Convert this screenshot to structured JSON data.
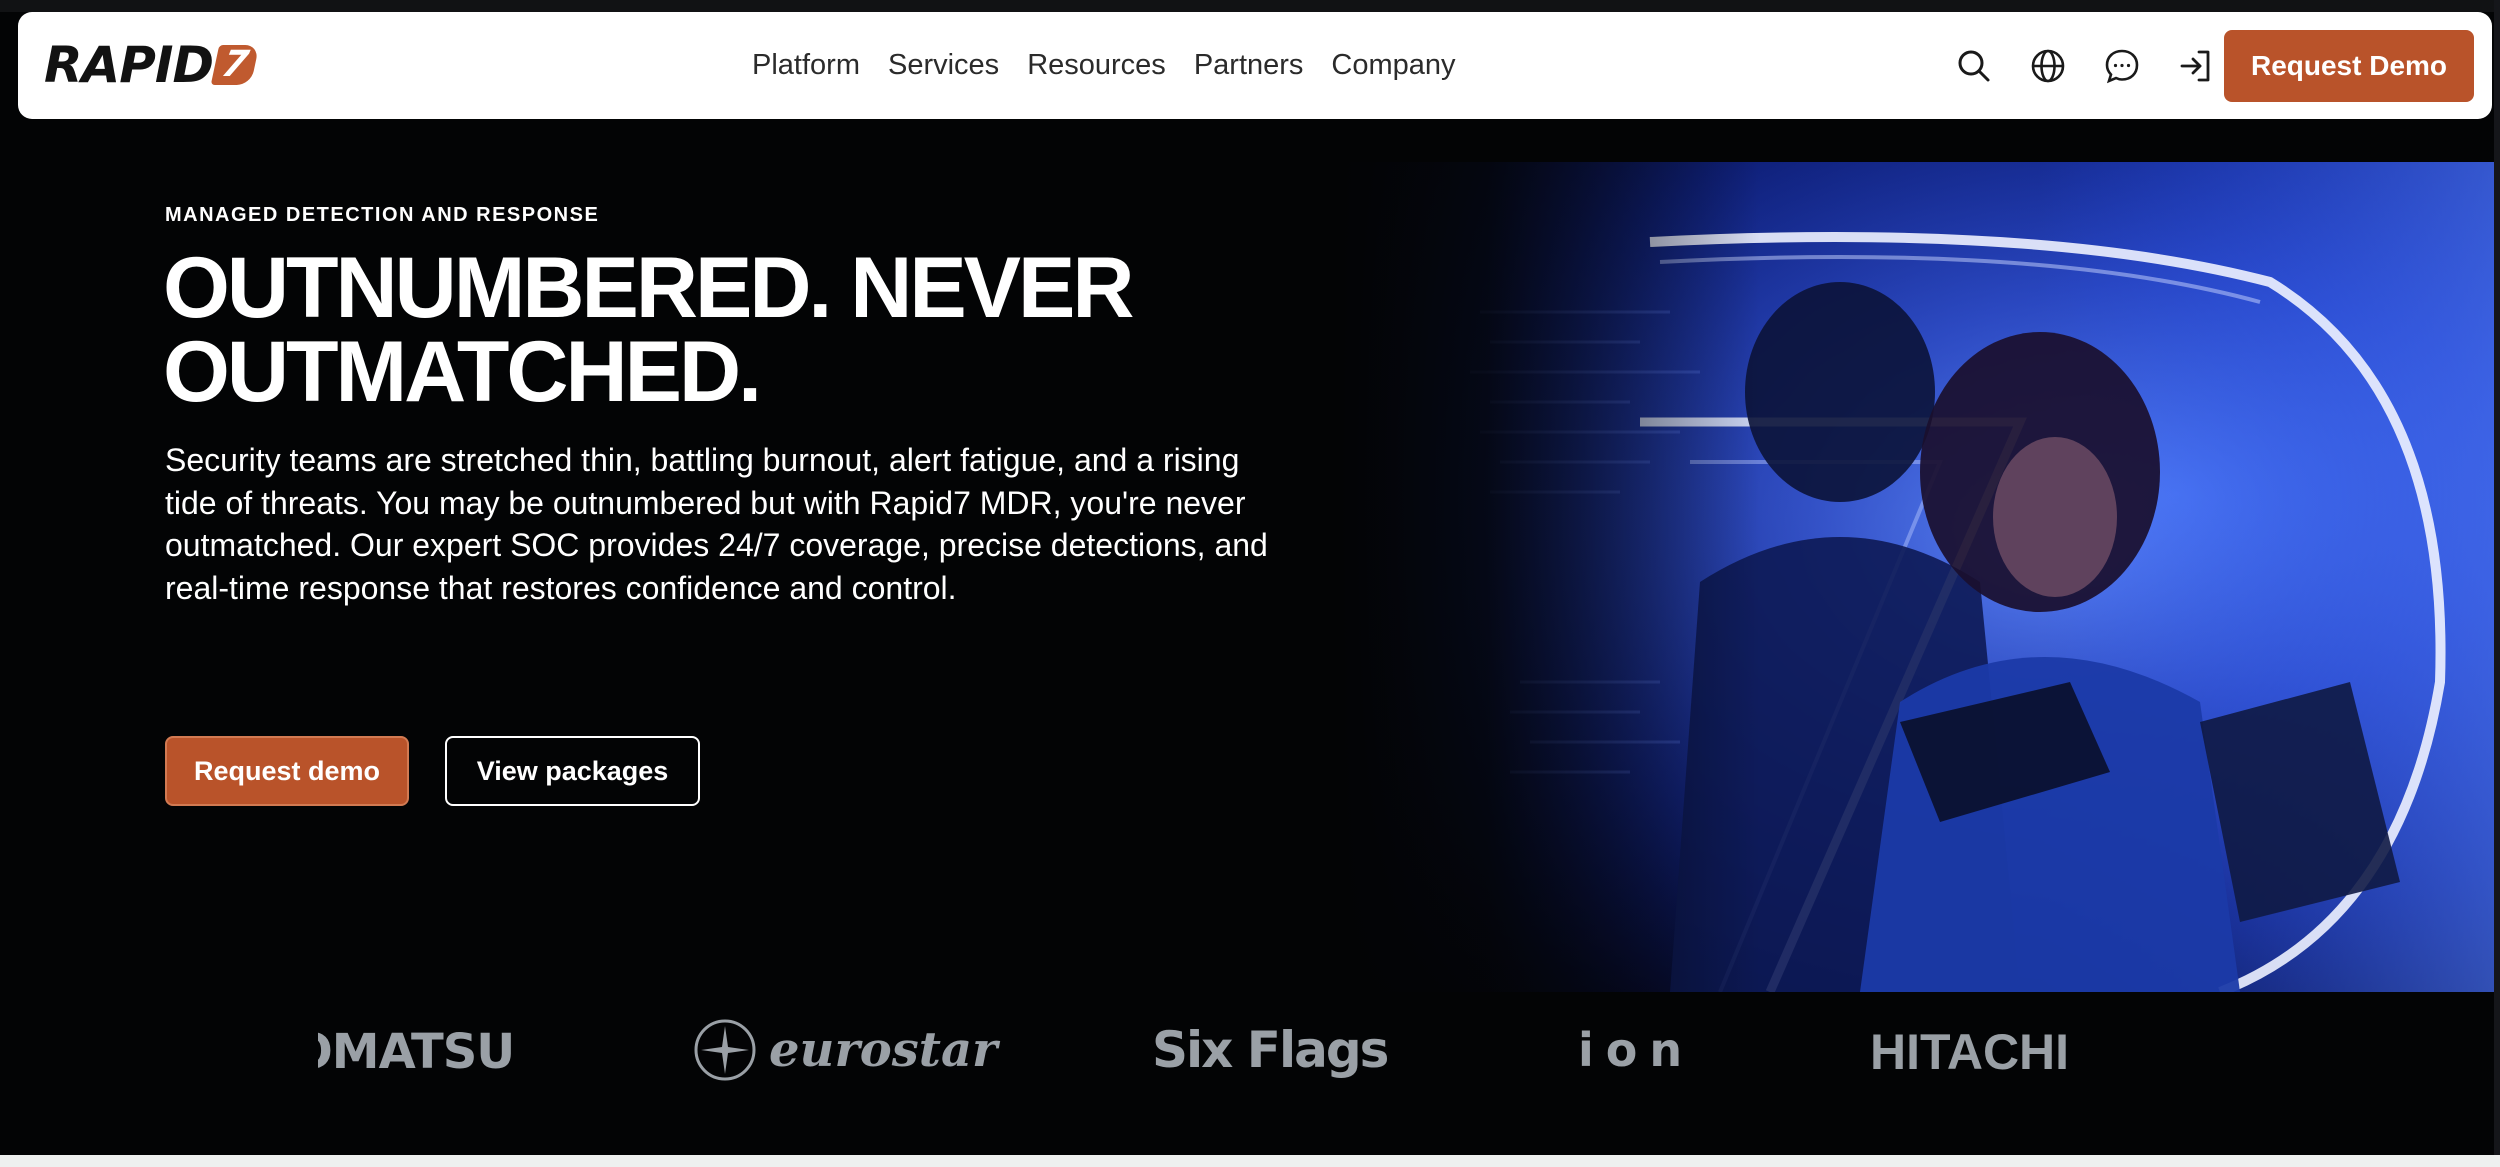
{
  "header": {
    "logo_text": "RAPID",
    "logo_mark": "7",
    "nav_items": [
      "Platform",
      "Services",
      "Resources",
      "Partners",
      "Company"
    ],
    "icons": [
      "search-icon",
      "globe-icon",
      "chat-icon",
      "sign-in-icon"
    ],
    "cta_label": "Request Demo"
  },
  "hero": {
    "eyebrow": "MANAGED DETECTION AND RESPONSE",
    "headline": "OUTNUMBERED. NEVER OUTMATCHED.",
    "description": "Security teams are stretched thin, battling burnout, alert fatigue, and a rising tide of threats. You may be outnumbered but with Rapid7 MDR, you're never outmatched. Our expert SOC provides 24/7 coverage, precise detections, and real-time response that restores confidence and control.",
    "primary_button": "Request demo",
    "secondary_button": "View packages"
  },
  "client_logos": [
    "OMATSU",
    "eurostar",
    "Six Flags",
    "ion",
    "HITACHI"
  ],
  "colors": {
    "accent": "#b9532a",
    "background": "#030405",
    "logo_gray": "#9aa0a6"
  }
}
